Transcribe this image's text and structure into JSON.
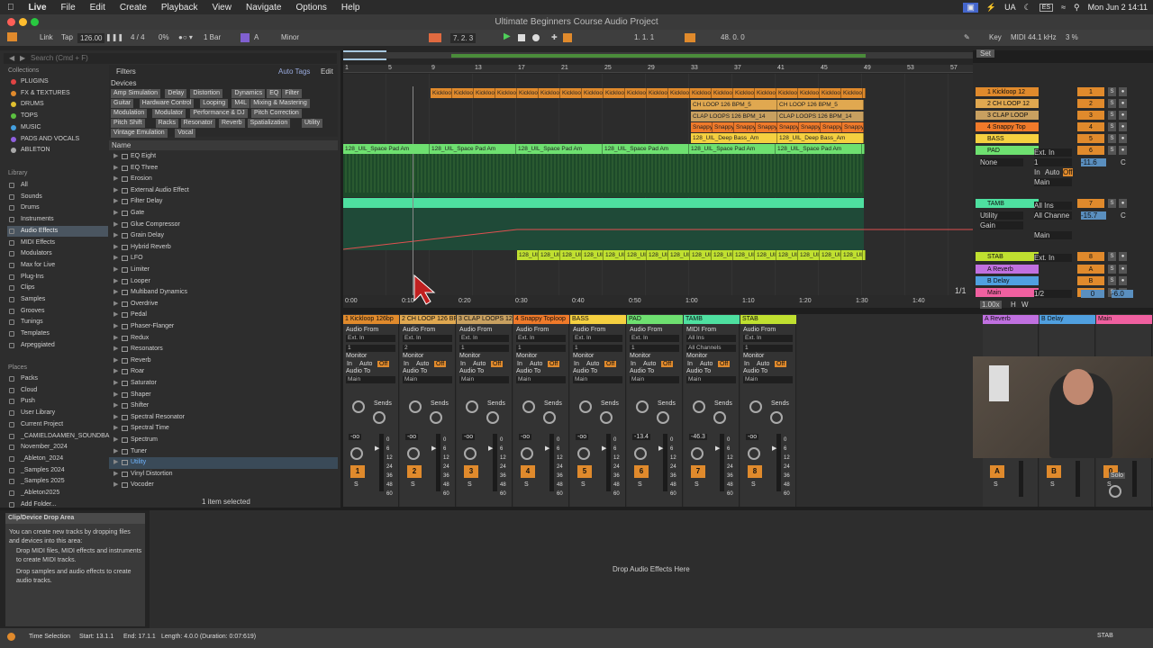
{
  "menubar": {
    "app": "Live",
    "items": [
      "File",
      "Edit",
      "Create",
      "Playback",
      "View",
      "Navigate",
      "Options",
      "Help"
    ],
    "lang": "UA",
    "lang2": "ES",
    "datetime": "Mon Jun 2  14:11"
  },
  "window": {
    "title": "Ultimate Beginners Course Audio Project"
  },
  "transport": {
    "link": "Link",
    "tap": "Tap",
    "tempo": "126.00",
    "sig": "4 / 4",
    "pct": "0%",
    "quant": "1 Bar",
    "key_root": "A",
    "scale": "Minor",
    "position": "7.  2.  3",
    "loop_start": "1.  1.  1",
    "loop_len": "48.  0.  0",
    "key": "Key",
    "midi": "MIDI",
    "sample_rate": "44.1 kHz",
    "cpu": "3 %"
  },
  "browser": {
    "search_placeholder": "Search (Cmd + F)",
    "collections_h": "Collections",
    "collections": [
      "PLUGINS",
      "FX & TEXTURES",
      "DRUMS",
      "TOPS",
      "MUSIC",
      "PADS AND VOCALS",
      "ABLETON"
    ],
    "collection_colors": [
      "#e04444",
      "#e08a2c",
      "#e0c030",
      "#5bc040",
      "#44a0e0",
      "#9060e0",
      "#aaaaaa"
    ],
    "library_h": "Library",
    "library": [
      "All",
      "Sounds",
      "Drums",
      "Instruments",
      "Audio Effects",
      "MIDI Effects",
      "Modulators",
      "Max for Live",
      "Plug-Ins",
      "Clips",
      "Samples",
      "Grooves",
      "Tunings",
      "Templates",
      "Arpeggiated"
    ],
    "places_h": "Places",
    "places": [
      "Packs",
      "Cloud",
      "Push",
      "User Library",
      "Current Project",
      "_CAMIELDAAMEN_SOUNDBA",
      "November_2024",
      "_Ableton_2024",
      "_Samples 2024",
      "_Samples 2025",
      "_Ableton2025",
      "Add Folder..."
    ],
    "filters_label": "Filters",
    "auto_tags": "Auto Tags",
    "edit": "Edit",
    "devices_label": "Devices",
    "tags": [
      "Amp Simulation",
      "Delay",
      "Distortion",
      "Dynamics",
      "EQ",
      "Filter",
      "Guitar",
      "Hardware Control",
      "Looping",
      "M4L",
      "Mixing & Mastering",
      "Modulation",
      "Modulator",
      "Performance & DJ",
      "Pitch Correction",
      "Pitch Shift",
      "Racks",
      "Resonator",
      "Reverb",
      "Spatialization",
      "Utility",
      "Vintage Emulation",
      "Vocal"
    ],
    "name_header": "Name",
    "items": [
      "EQ Eight",
      "EQ Three",
      "Erosion",
      "External Audio Effect",
      "Filter Delay",
      "Gate",
      "Glue Compressor",
      "Grain Delay",
      "Hybrid Reverb",
      "LFO",
      "Limiter",
      "Looper",
      "Multiband Dynamics",
      "Overdrive",
      "Pedal",
      "Phaser-Flanger",
      "Redux",
      "Resonators",
      "Reverb",
      "Roar",
      "Saturator",
      "Shaper",
      "Shifter",
      "Spectral Resonator",
      "Spectral Time",
      "Spectrum",
      "Tuner",
      "Utility",
      "Vinyl Distortion",
      "Vocoder"
    ],
    "selected_item": "Utility",
    "footer": "1 item selected"
  },
  "arrangement": {
    "bars": [
      "1",
      "5",
      "9",
      "13",
      "17",
      "21",
      "25",
      "29",
      "33",
      "37",
      "41",
      "45",
      "49",
      "53",
      "57"
    ],
    "times": [
      "0:00",
      "0:10",
      "0:20",
      "0:30",
      "0:40",
      "0:50",
      "1:00",
      "1:10",
      "1:20",
      "1:30",
      "1:40"
    ],
    "set_label": "Set",
    "zoom_indicator": "1/1",
    "clips": {
      "kick": "Kickloo",
      "ch": "CH LOOP 126 BPM_5",
      "ch2": "CH LOOP 126 BPM_5",
      "clap": "CLAP LOOPS 126 BPM_14",
      "clap2": "CLAP LOOPS 126 BPM_14",
      "snap": "Snappy Toploo",
      "bass": "128_UIL_Deep Bass_Am",
      "pad": "128_UIL_Space Pad Am",
      "stab": "128_UIL_Stab"
    }
  },
  "tracks": [
    {
      "name": "1 Kickloop 12",
      "num": "1",
      "color": "#e08a2c"
    },
    {
      "name": "2 CH LOOP 12",
      "num": "2",
      "color": "#e0a850"
    },
    {
      "name": "3 CLAP LOOP",
      "num": "3",
      "color": "#c8a060"
    },
    {
      "name": "4 Snappy Top",
      "num": "4",
      "color": "#f07a2a"
    },
    {
      "name": "BASS",
      "num": "5",
      "color": "#f5d040"
    },
    {
      "name": "PAD",
      "num": "6",
      "color": "#6ee070"
    },
    {
      "name": "TAMB",
      "num": "7",
      "color": "#4ee0a0"
    },
    {
      "name": "STAB",
      "num": "8",
      "color": "#c0e030"
    },
    {
      "name": "A Reverb",
      "num": "A",
      "color": "#c070e0"
    },
    {
      "name": "B Delay",
      "num": "B",
      "color": "#50a0e0"
    },
    {
      "name": "Main",
      "num": "0",
      "color": "#f060a0"
    }
  ],
  "trackheads": {
    "pad_in": "Ext. In",
    "pad_none": "None",
    "pad_ch": "1",
    "pad_vol": "-11.6",
    "pad_pan": "C",
    "tamb_in": "All Ins",
    "tamb_ch": "All Channe",
    "tamb_vol": "-15.7",
    "tamb_pan": "C",
    "utility": "Utility",
    "gain": "Gain",
    "main": "Main",
    "auto": "Auto",
    "off": "Off",
    "in": "In",
    "main_vol": "0",
    "main_val": "-6.0",
    "main_out": "1/2",
    "stab_in": "Ext. In",
    "zoom": "1.00x",
    "h": "H",
    "w": "W"
  },
  "mixer": {
    "strips": [
      {
        "name": "1 Kickloop 126bp",
        "color": "#e08a2c",
        "from": "Audio From",
        "in": "Ext. In",
        "ch": "1",
        "vol": "-oo",
        "num": "1",
        "numcolor": "#e08a2c"
      },
      {
        "name": "2 CH LOOP 126 BP",
        "color": "#e0a850",
        "from": "Audio From",
        "in": "Ext. In",
        "ch": "2",
        "vol": "-oo",
        "num": "2",
        "numcolor": "#e08a2c"
      },
      {
        "name": "3 CLAP LOOPS 12",
        "color": "#c8a060",
        "from": "Audio From",
        "in": "Ext. In",
        "ch": "1",
        "vol": "-oo",
        "num": "3",
        "numcolor": "#e08a2c"
      },
      {
        "name": "4 Snappy Toploop",
        "color": "#f07a2a",
        "from": "Audio From",
        "in": "Ext. In",
        "ch": "1",
        "vol": "-oo",
        "num": "4",
        "numcolor": "#e08a2c"
      },
      {
        "name": "BASS",
        "color": "#f5d040",
        "from": "Audio From",
        "in": "Ext. In",
        "ch": "1",
        "vol": "-oo",
        "num": "5",
        "numcolor": "#e08a2c"
      },
      {
        "name": "PAD",
        "color": "#6ee070",
        "from": "Audio From",
        "in": "Ext. In",
        "ch": "1",
        "vol": "-13.4",
        "num": "6",
        "numcolor": "#e08a2c"
      },
      {
        "name": "TAMB",
        "color": "#4ee0a0",
        "from": "MIDI From",
        "in": "All Ins",
        "ch": "All Channels",
        "vol": "-46.3",
        "num": "7",
        "numcolor": "#e08a2c"
      },
      {
        "name": "STAB",
        "color": "#c0e030",
        "from": "Audio From",
        "in": "Ext. In",
        "ch": "1",
        "vol": "-oo",
        "num": "8",
        "numcolor": "#e08a2c"
      }
    ],
    "monitor": "Monitor",
    "in": "In",
    "auto": "Auto",
    "off": "Off",
    "audio_to": "Audio To",
    "main": "Main",
    "sends": "Sends",
    "s": "S",
    "returns": [
      {
        "name": "A Reverb",
        "color": "#c070e0",
        "num": "A"
      },
      {
        "name": "B Delay",
        "color": "#50a0e0",
        "num": "B"
      },
      {
        "name": "Main",
        "color": "#f060a0",
        "num": "0"
      }
    ],
    "solo": "Solo",
    "db_scale": [
      "0",
      "6",
      "12",
      "24",
      "36",
      "48",
      "60"
    ]
  },
  "info": {
    "title": "Clip/Device Drop Area",
    "text": "You can create new tracks by dropping files and devices into this area:",
    "b1": "Drop MIDI files, MIDI effects and instruments to create MIDI tracks.",
    "b2": "Drop samples and audio effects to create audio tracks."
  },
  "drop": "Drop Audio Effects Here",
  "status": {
    "time_sel": "Time Selection",
    "start": "Start: 13.1.1",
    "end": "End: 17.1.1",
    "length": "Length: 4.0.0 (Duration: 0:07:619)",
    "track": "STAB"
  }
}
